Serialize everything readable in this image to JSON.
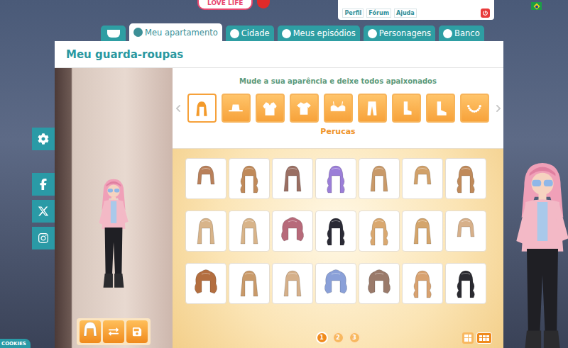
{
  "logo": {
    "text": "LOVE LIFE"
  },
  "account": {
    "links": [
      {
        "label": "Perfil"
      },
      {
        "label": "Fórum"
      },
      {
        "label": "Ajuda"
      }
    ]
  },
  "nav": {
    "tabs": [
      {
        "label": "",
        "kind": "home",
        "selected": false
      },
      {
        "label": "Meu apartamento",
        "kind": "apartment",
        "selected": true
      },
      {
        "label": "Cidade",
        "kind": "city",
        "selected": false
      },
      {
        "label": "Meus episódios",
        "kind": "episodes",
        "selected": false
      },
      {
        "label": "Personagens",
        "kind": "characters",
        "selected": false
      },
      {
        "label": "Banco",
        "kind": "bank",
        "selected": false
      }
    ]
  },
  "wardrobe": {
    "title": "Meu guarda-roupas",
    "subtitle": "Mude a sua aparência e deixe todos apaixonados",
    "categories": [
      {
        "kind": "wig",
        "selected": true
      },
      {
        "kind": "hat",
        "selected": false
      },
      {
        "kind": "jacket",
        "selected": false
      },
      {
        "kind": "shirt",
        "selected": false
      },
      {
        "kind": "bra",
        "selected": false
      },
      {
        "kind": "pants",
        "selected": false
      },
      {
        "kind": "sock",
        "selected": false
      },
      {
        "kind": "boot",
        "selected": false
      },
      {
        "kind": "necklace",
        "selected": false
      }
    ],
    "category_label": "Perucas",
    "wigs": [
      {
        "kind": "bob",
        "color": "#b9805a"
      },
      {
        "kind": "wavy",
        "color": "#c08a5a"
      },
      {
        "kind": "long",
        "color": "#9a6f63"
      },
      {
        "kind": "wavy",
        "color": "#9b7ed8"
      },
      {
        "kind": "long",
        "color": "#c99a6a"
      },
      {
        "kind": "bob",
        "color": "#d1a16a"
      },
      {
        "kind": "wavy",
        "color": "#c08a5a"
      },
      {
        "kind": "long",
        "color": "#d8b48a"
      },
      {
        "kind": "long",
        "color": "#d8b48a"
      },
      {
        "kind": "curly",
        "color": "#b76a7a"
      },
      {
        "kind": "wavy",
        "color": "#2a2a35"
      },
      {
        "kind": "wavy",
        "color": "#d9a870"
      },
      {
        "kind": "long",
        "color": "#d4a56c"
      },
      {
        "kind": "bob",
        "color": "#d7b08a"
      },
      {
        "kind": "curly",
        "color": "#b36e3f"
      },
      {
        "kind": "long",
        "color": "#c99a6a"
      },
      {
        "kind": "long",
        "color": "#d5b08a"
      },
      {
        "kind": "curly",
        "color": "#8aa0d8"
      },
      {
        "kind": "curly",
        "color": "#9a7a6a"
      },
      {
        "kind": "wavy",
        "color": "#d8a270"
      },
      {
        "kind": "wavy",
        "color": "#2a2a30"
      }
    ],
    "pages": [
      {
        "label": "1",
        "selected": true
      },
      {
        "label": "2",
        "selected": false
      },
      {
        "label": "3",
        "selected": false
      }
    ],
    "views": [
      {
        "kind": "large",
        "selected": false
      },
      {
        "kind": "small",
        "selected": true
      }
    ]
  },
  "cookies": {
    "label": "COOKIES"
  }
}
